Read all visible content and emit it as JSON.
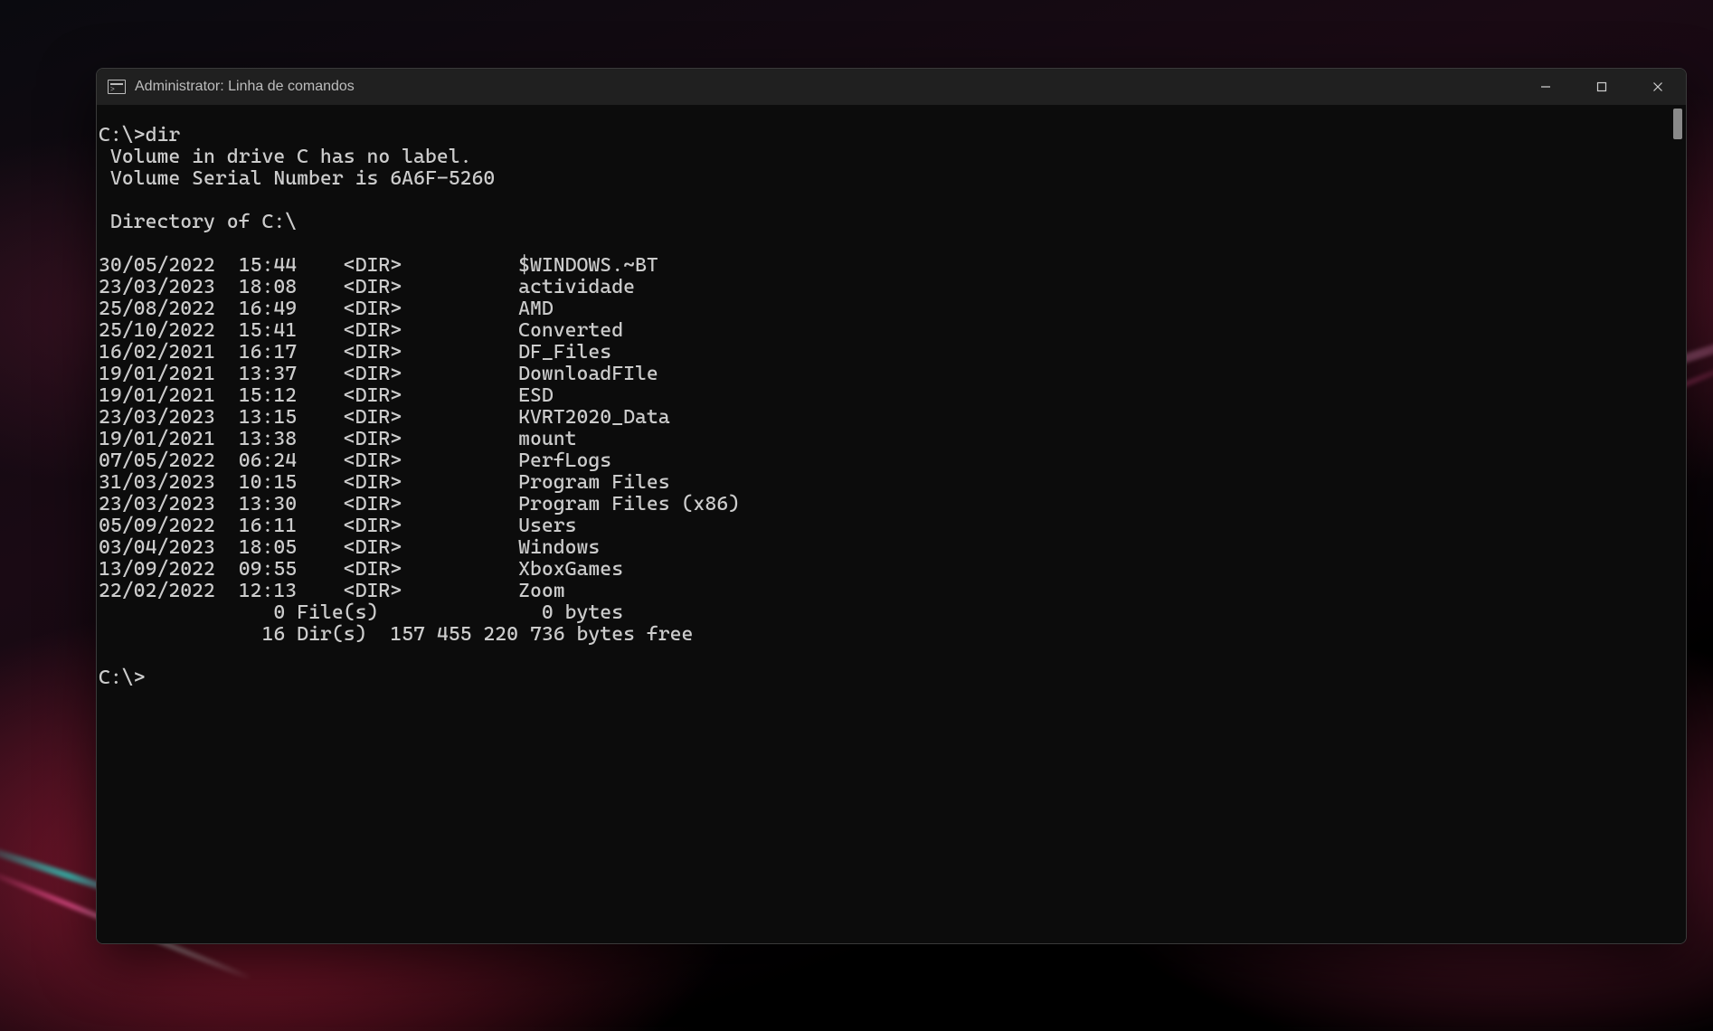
{
  "window": {
    "title": "Administrator: Linha de comandos"
  },
  "terminal": {
    "prompt1": "C:\\>dir",
    "volume_label_line": " Volume in drive C has no label.",
    "volume_serial_line": " Volume Serial Number is 6A6F-5260",
    "directory_of_line": " Directory of C:\\",
    "entries": [
      {
        "date": "30/05/2022",
        "time": "15:44",
        "type": "<DIR>",
        "size": "",
        "name": "$WINDOWS.~BT"
      },
      {
        "date": "23/03/2023",
        "time": "18:08",
        "type": "<DIR>",
        "size": "",
        "name": "actividade"
      },
      {
        "date": "25/08/2022",
        "time": "16:49",
        "type": "<DIR>",
        "size": "",
        "name": "AMD"
      },
      {
        "date": "25/10/2022",
        "time": "15:41",
        "type": "<DIR>",
        "size": "",
        "name": "Converted"
      },
      {
        "date": "16/02/2021",
        "time": "16:17",
        "type": "<DIR>",
        "size": "",
        "name": "DF_Files"
      },
      {
        "date": "19/01/2021",
        "time": "13:37",
        "type": "<DIR>",
        "size": "",
        "name": "DownloadFIle"
      },
      {
        "date": "19/01/2021",
        "time": "15:12",
        "type": "<DIR>",
        "size": "",
        "name": "ESD"
      },
      {
        "date": "23/03/2023",
        "time": "13:15",
        "type": "<DIR>",
        "size": "",
        "name": "KVRT2020_Data"
      },
      {
        "date": "19/01/2021",
        "time": "13:38",
        "type": "<DIR>",
        "size": "",
        "name": "mount"
      },
      {
        "date": "07/05/2022",
        "time": "06:24",
        "type": "<DIR>",
        "size": "",
        "name": "PerfLogs"
      },
      {
        "date": "31/03/2023",
        "time": "10:15",
        "type": "<DIR>",
        "size": "",
        "name": "Program Files"
      },
      {
        "date": "23/03/2023",
        "time": "13:30",
        "type": "<DIR>",
        "size": "",
        "name": "Program Files (x86)"
      },
      {
        "date": "05/09/2022",
        "time": "16:11",
        "type": "<DIR>",
        "size": "",
        "name": "Users"
      },
      {
        "date": "03/04/2023",
        "time": "18:05",
        "type": "<DIR>",
        "size": "",
        "name": "Windows"
      },
      {
        "date": "13/09/2022",
        "time": "09:55",
        "type": "<DIR>",
        "size": "",
        "name": "XboxGames"
      },
      {
        "date": "22/02/2022",
        "time": "12:13",
        "type": "<DIR>",
        "size": "",
        "name": "Zoom"
      }
    ],
    "files_summary": "               0 File(s)              0 bytes",
    "dirs_summary": "              16 Dir(s)  157 455 220 736 bytes free",
    "prompt2": "C:\\>"
  }
}
